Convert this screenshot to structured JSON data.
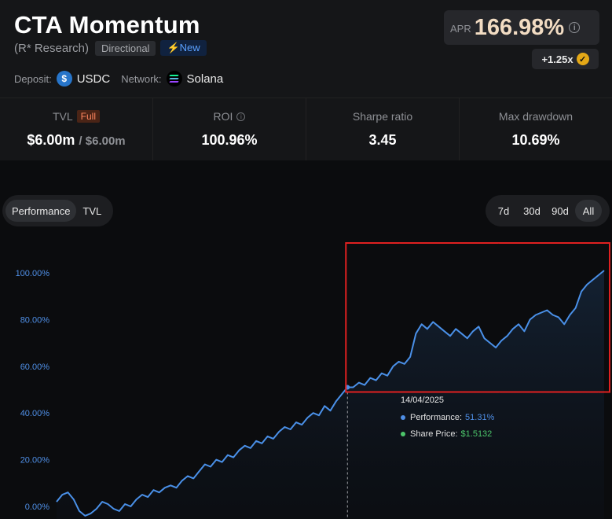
{
  "header": {
    "title": "CTA Momentum",
    "provider": "(R* Research)",
    "tag_directional": "Directional",
    "tag_new": "New",
    "deposit_label": "Deposit:",
    "deposit_token": "USDC",
    "network_label": "Network:",
    "network_name": "Solana"
  },
  "apr": {
    "label": "APR",
    "value": "166.98%",
    "boost": "+1.25x"
  },
  "stats": {
    "tvl_label": "TVL",
    "tvl_badge": "Full",
    "tvl_value": "$6.00m",
    "tvl_cap": "/ $6.00m",
    "roi_label": "ROI",
    "roi_value": "100.96%",
    "sharpe_label": "Sharpe ratio",
    "sharpe_value": "3.45",
    "drawdown_label": "Max drawdown",
    "drawdown_value": "10.69%"
  },
  "toggle": {
    "performance": "Performance",
    "tvl": "TVL"
  },
  "ranges": [
    "7d",
    "30d",
    "90d",
    "All"
  ],
  "tooltip": {
    "date": "14/04/2025",
    "perf_label": "Performance:",
    "perf_value": "51.31%",
    "share_label": "Share Price:",
    "share_value": "$1.5132"
  },
  "colors": {
    "line": "#4a90e8",
    "highlight_box": "#e02020",
    "apr": "#f2dcc3"
  },
  "chart_data": {
    "type": "area",
    "y_ticks": [
      "100.00%",
      "80.00%",
      "60.00%",
      "40.00%",
      "20.00%",
      "0.00%"
    ],
    "ylim": [
      0,
      100
    ],
    "highlight_start_index": 51,
    "series": [
      {
        "values": [
          2,
          5,
          6,
          3,
          -2,
          -4,
          -3,
          -1,
          2,
          1,
          -1,
          -2,
          1,
          0,
          3,
          5,
          4,
          7,
          6,
          8,
          9,
          8,
          11,
          13,
          12,
          15,
          18,
          17,
          20,
          19,
          22,
          21,
          24,
          26,
          25,
          28,
          27,
          30,
          29,
          32,
          34,
          33,
          36,
          35,
          38,
          40,
          39,
          43,
          41,
          45,
          48,
          51,
          51,
          53,
          52,
          55,
          54,
          57,
          56,
          60,
          62,
          61,
          64,
          74,
          78,
          76,
          79,
          77,
          75,
          73,
          76,
          74,
          72,
          75,
          77,
          72,
          70,
          68,
          71,
          73,
          76,
          78,
          75,
          80,
          82,
          83,
          84,
          82,
          81,
          78,
          82,
          85,
          92,
          95,
          97,
          99,
          101
        ]
      }
    ]
  }
}
